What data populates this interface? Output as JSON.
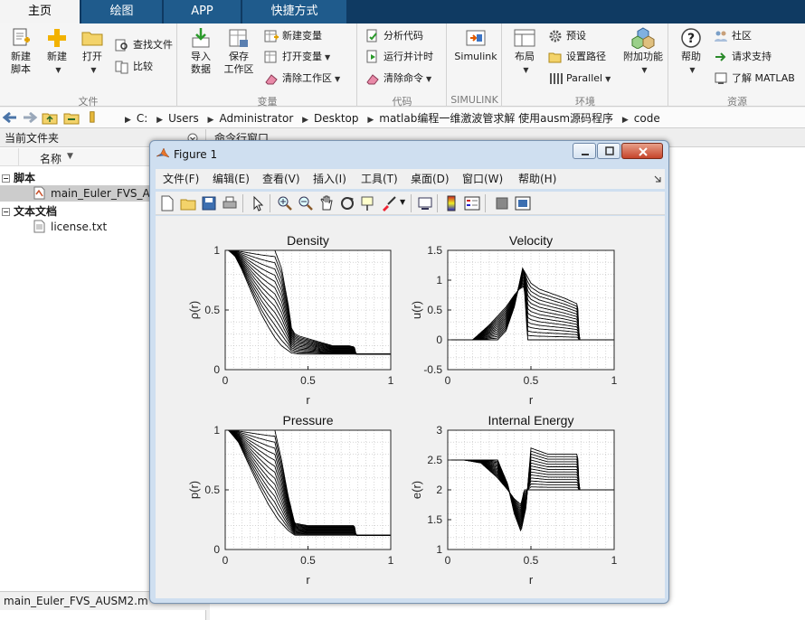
{
  "tabs": [
    {
      "label": "主页",
      "active": true
    },
    {
      "label": "绘图",
      "active": false
    },
    {
      "label": "APP",
      "active": false
    },
    {
      "label": "快捷方式",
      "active": false
    }
  ],
  "ribbon": {
    "groups": {
      "file": "文件",
      "variable": "变量",
      "code": "代码",
      "simulink": "SIMULINK",
      "environment": "环境",
      "resources": "资源"
    },
    "new_script": "新建\n脚本",
    "new": "新建",
    "open": "打开",
    "find_files": "查找文件",
    "compare": "比较",
    "import_data": "导入\n数据",
    "save_workspace": "保存\n工作区",
    "new_variable": "新建变量",
    "open_variable": "打开变量",
    "clear_workspace": "清除工作区",
    "analyze_code": "分析代码",
    "run_and_time": "运行并计时",
    "clear_commands": "清除命令",
    "simulink": "Simulink",
    "layout": "布局",
    "preferences": "预设",
    "set_path": "设置路径",
    "parallel": "Parallel",
    "addons": "附加功能",
    "help": "帮助",
    "community": "社区",
    "request_support": "请求支持",
    "learn_matlab": "了解 MATLAB"
  },
  "address": {
    "crumbs": [
      "C:",
      "Users",
      "Administrator",
      "Desktop",
      "matlab编程一维激波管求解 使用ausm源码程序",
      "code"
    ]
  },
  "left_panel": {
    "title": "当前文件夹",
    "column_name": "名称",
    "group_scripts": "脚本",
    "file_script": "main_Euler_FVS_AUSM2.m",
    "group_text": "文本文档",
    "file_text": "license.txt",
    "status_file": "main_Euler_FVS_AUSM2.m"
  },
  "right_panel": {
    "title": "命令行窗口"
  },
  "figure": {
    "title": "Figure 1",
    "menus": [
      "文件(F)",
      "编辑(E)",
      "查看(V)",
      "插入(I)",
      "工具(T)",
      "桌面(D)",
      "窗口(W)",
      "帮助(H)"
    ]
  },
  "chart_data": [
    {
      "type": "line",
      "title": "Density",
      "xlabel": "r",
      "ylabel": "ρ(r)",
      "xlim": [
        0,
        1
      ],
      "ylim": [
        0,
        1
      ],
      "xticks": [
        0,
        0.5,
        1
      ],
      "yticks": [
        0,
        0.5,
        1
      ],
      "grid": "dotted",
      "series_count": 15,
      "series_first": {
        "x": [
          0,
          0.02,
          0.06,
          0.1,
          0.14,
          0.18,
          0.22,
          0.26,
          0.3,
          0.34,
          0.38,
          0.4,
          0.45,
          0.5,
          0.6,
          0.7,
          0.8,
          1
        ],
        "y": [
          1,
          1,
          0.95,
          0.84,
          0.71,
          0.58,
          0.46,
          0.36,
          0.27,
          0.2,
          0.16,
          0.14,
          0.13,
          0.13,
          0.13,
          0.13,
          0.13,
          0.13
        ]
      },
      "series_last": {
        "x": [
          0,
          0.2,
          0.3,
          0.34,
          0.38,
          0.4,
          0.42,
          0.45,
          0.55,
          0.65,
          0.75,
          0.78,
          0.79,
          0.8,
          1
        ],
        "y": [
          1,
          1,
          1,
          0.85,
          0.55,
          0.35,
          0.3,
          0.28,
          0.24,
          0.2,
          0.2,
          0.19,
          0.13,
          0.13,
          0.13
        ]
      }
    },
    {
      "type": "line",
      "title": "Velocity",
      "xlabel": "r",
      "ylabel": "u(r)",
      "xlim": [
        0,
        1
      ],
      "ylim": [
        -0.5,
        1.5
      ],
      "xticks": [
        0,
        0.5,
        1
      ],
      "yticks": [
        -0.5,
        0,
        0.5,
        1,
        1.5
      ],
      "grid": "dotted",
      "series_count": 15,
      "series_first": {
        "x": [
          0,
          0.07,
          0.15,
          0.25,
          0.35,
          0.4,
          0.43,
          0.46,
          0.48,
          0.5,
          1
        ],
        "y": [
          0,
          0,
          0,
          0.25,
          0.55,
          0.75,
          0.85,
          0.9,
          0,
          0,
          0
        ]
      },
      "series_last": {
        "x": [
          0,
          0.3,
          0.35,
          0.4,
          0.45,
          0.5,
          0.55,
          0.6,
          0.7,
          0.78,
          0.79,
          1
        ],
        "y": [
          0,
          0,
          0.15,
          0.55,
          1.2,
          0.95,
          0.85,
          0.8,
          0.7,
          0.6,
          0,
          0
        ]
      }
    },
    {
      "type": "line",
      "title": "Pressure",
      "xlabel": "r",
      "ylabel": "p(r)",
      "xlim": [
        0,
        1
      ],
      "ylim": [
        0,
        1
      ],
      "xticks": [
        0,
        0.5,
        1
      ],
      "yticks": [
        0,
        0.5,
        1
      ],
      "grid": "dotted",
      "series_count": 15,
      "series_first": {
        "x": [
          0,
          0.02,
          0.08,
          0.14,
          0.2,
          0.26,
          0.32,
          0.38,
          0.42,
          0.5,
          1
        ],
        "y": [
          1,
          1,
          0.9,
          0.72,
          0.54,
          0.38,
          0.25,
          0.16,
          0.12,
          0.12,
          0.12
        ]
      },
      "series_last": {
        "x": [
          0,
          0.2,
          0.3,
          0.34,
          0.38,
          0.42,
          0.5,
          0.6,
          0.78,
          0.79,
          1
        ],
        "y": [
          1,
          1,
          1,
          0.75,
          0.45,
          0.22,
          0.2,
          0.2,
          0.2,
          0.12,
          0.12
        ]
      }
    },
    {
      "type": "line",
      "title": "Internal Energy",
      "xlabel": "r",
      "ylabel": "e(r)",
      "xlim": [
        0,
        1
      ],
      "ylim": [
        1,
        3
      ],
      "xticks": [
        0,
        0.5,
        1
      ],
      "yticks": [
        1,
        1.5,
        2,
        2.5,
        3
      ],
      "grid": "dotted",
      "series_count": 15,
      "series_first": {
        "x": [
          0,
          0.1,
          0.2,
          0.3,
          0.36,
          0.4,
          0.44,
          0.46,
          0.5,
          1
        ],
        "y": [
          2.5,
          2.5,
          2.45,
          2.2,
          2.0,
          1.85,
          1.75,
          2.0,
          2.0,
          2.0
        ]
      },
      "series_last": {
        "x": [
          0,
          0.2,
          0.3,
          0.36,
          0.4,
          0.44,
          0.47,
          0.5,
          0.6,
          0.78,
          0.79,
          1
        ],
        "y": [
          2.5,
          2.5,
          2.5,
          2.1,
          1.6,
          1.3,
          1.7,
          2.7,
          2.6,
          2.6,
          2.0,
          2.0
        ]
      }
    }
  ]
}
